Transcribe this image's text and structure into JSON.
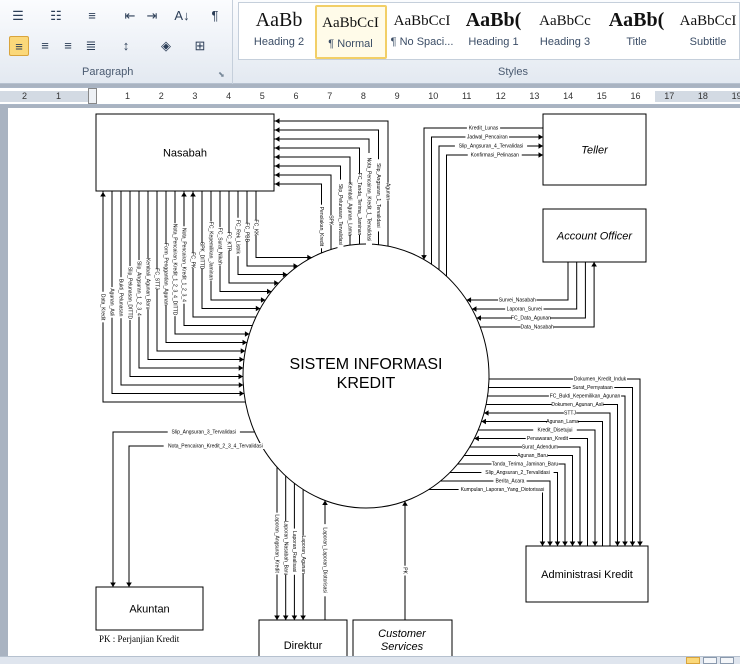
{
  "ribbon": {
    "paragraph": {
      "label": "Paragraph"
    },
    "styles": {
      "label": "Styles",
      "items": [
        {
          "preview": "AaBb",
          "name": "Heading 2"
        },
        {
          "preview": "AaBbCcI",
          "name": "¶ Normal",
          "selected": true
        },
        {
          "preview": "AaBbCcI",
          "name": "¶ No Spaci..."
        },
        {
          "preview": "AaBb(",
          "name": "Heading 1"
        },
        {
          "preview": "AaBbCc",
          "name": "Heading 3"
        },
        {
          "preview": "AaBb(",
          "name": "Title"
        },
        {
          "preview": "AaBbCcI",
          "name": "Subtitle"
        }
      ]
    }
  },
  "ruler": {
    "left_numbers": [
      "2",
      "1"
    ],
    "numbers": [
      "1",
      "2",
      "3",
      "4",
      "5",
      "6",
      "7",
      "8",
      "9",
      "10",
      "11",
      "12",
      "13",
      "14",
      "15",
      "16",
      "17",
      "18",
      "19"
    ]
  },
  "diagram": {
    "process": {
      "line1": "SISTEM INFORMASI",
      "line2": "KREDIT"
    },
    "entities": {
      "nasabah": "Nasabah",
      "teller": "Teller",
      "account_officer": "Account Officer",
      "administrasi": "Administrasi Kredit",
      "akuntan": "Akuntan",
      "direktur": "Direktur",
      "customer_services": "Customer Services"
    },
    "note": "PK  : Perjanjian Kredit",
    "flows": {
      "nasabah_top": [
        "Agunan",
        "Slip_Angsuran_1_Tervalidasi",
        "Nota_Pencairan_Kredit_1_Tervalidasi",
        "FC_Tanda_Terima_Jaminan",
        "Kembali_Agunan_Lama",
        "Slip_Pelunasan_Tervalidasi",
        "SPK",
        "Penolakan_Kredit"
      ],
      "nasabah_bottom": [
        {
          "label": "Data_Kredit",
          "to": "nasabah"
        },
        {
          "label": "Agunan_Asli",
          "to": "system"
        },
        {
          "label": "Bukti_Pelunasan",
          "to": "system"
        },
        {
          "label": "Slip_Pelunasan_DITTD",
          "to": "system"
        },
        {
          "label": "Slip_Angsuran_1_2_3_4",
          "to": "system"
        },
        {
          "label": "Kembali_Agunan_Baru",
          "to": "system"
        },
        {
          "label": "FC_STTJ",
          "to": "system"
        },
        {
          "label": "Form_Penggantian_Agunan",
          "to": "system"
        },
        {
          "label": "Nota_Pencairan_Kredit_1_2_3_4_DITTD",
          "to": "system"
        },
        {
          "label": "Nota_Pencairan_Kredit_1_2_3_4",
          "to": "nasabah"
        },
        {
          "label": "FC_PK",
          "to": "nasabah"
        },
        {
          "label": "SPK_DITTD",
          "to": "system"
        },
        {
          "label": "FC_Kepemilikan_Jaminan",
          "to": "system"
        },
        {
          "label": "FC_Surat_Nikah",
          "to": "system"
        },
        {
          "label": "FC_KTP",
          "to": "system"
        },
        {
          "label": "FC_Rek_Listrik",
          "to": "system"
        },
        {
          "label": "FC_PBB",
          "to": "system"
        },
        {
          "label": "FC_KK",
          "to": "system"
        }
      ],
      "teller": [
        {
          "label": "Kredit_Lunas",
          "to": "system"
        },
        {
          "label": "Jadwal_Pencairan",
          "to": "teller"
        },
        {
          "label": "Slip_Angsuran_4_Tervalidasi",
          "to": "teller"
        },
        {
          "label": "Konfirmasi_Pelinasan",
          "to": "teller"
        }
      ],
      "account_officer": [
        {
          "label": "Survei_Nasabah",
          "to": "system"
        },
        {
          "label": "Laporan_Survei",
          "to": "system"
        },
        {
          "label": "FC_Data_Agunan",
          "to": "system"
        },
        {
          "label": "Data_Nasabah",
          "to": "account_officer"
        }
      ],
      "administrasi": [
        {
          "label": "Dokumen_Kredit_Induk",
          "to": "administrasi"
        },
        {
          "label": "Surat_Pernyataan",
          "to": "administrasi"
        },
        {
          "label": "FC_Bukti_Kepemilikan_Agunan",
          "to": "administrasi"
        },
        {
          "label": "Dokumen_Agunan_Asli",
          "to": "administrasi"
        },
        {
          "label": "STTJ",
          "to": "system"
        },
        {
          "label": "Agunan_Lama",
          "to": "system"
        },
        {
          "label": "Kredit_Disetujui",
          "to": "administrasi"
        },
        {
          "label": "Penawaran_Kredit",
          "to": "system"
        },
        {
          "label": "Surat_Adendum",
          "to": "administrasi"
        },
        {
          "label": "Agunan_Baru",
          "to": "administrasi"
        },
        {
          "label": "Tanda_Terima_Jaminan_Baru",
          "to": "administrasi"
        },
        {
          "label": "Slip_Angsuran_2_Tervalidasi",
          "to": "administrasi"
        },
        {
          "label": "Berita_Acara",
          "to": "administrasi"
        },
        {
          "label": "Kumpulan_Laporan_Yang_Diotorisasi",
          "to": "administrasi"
        }
      ],
      "akuntan": [
        "Slip_Angsuran_3_Tervalidasi",
        "Nota_Pencairan_Kredit_2_3_4_Tervalidasi"
      ],
      "direktur_in": [
        "Laporan_Angsuran_Kredit",
        "Laporan_Nasabah_Baru",
        "Laporan_Realisasi",
        "Laporan_Agunan"
      ],
      "direktur_out": "Laporan_Laporan_Diotorisasi",
      "customer_services": "PK"
    }
  }
}
